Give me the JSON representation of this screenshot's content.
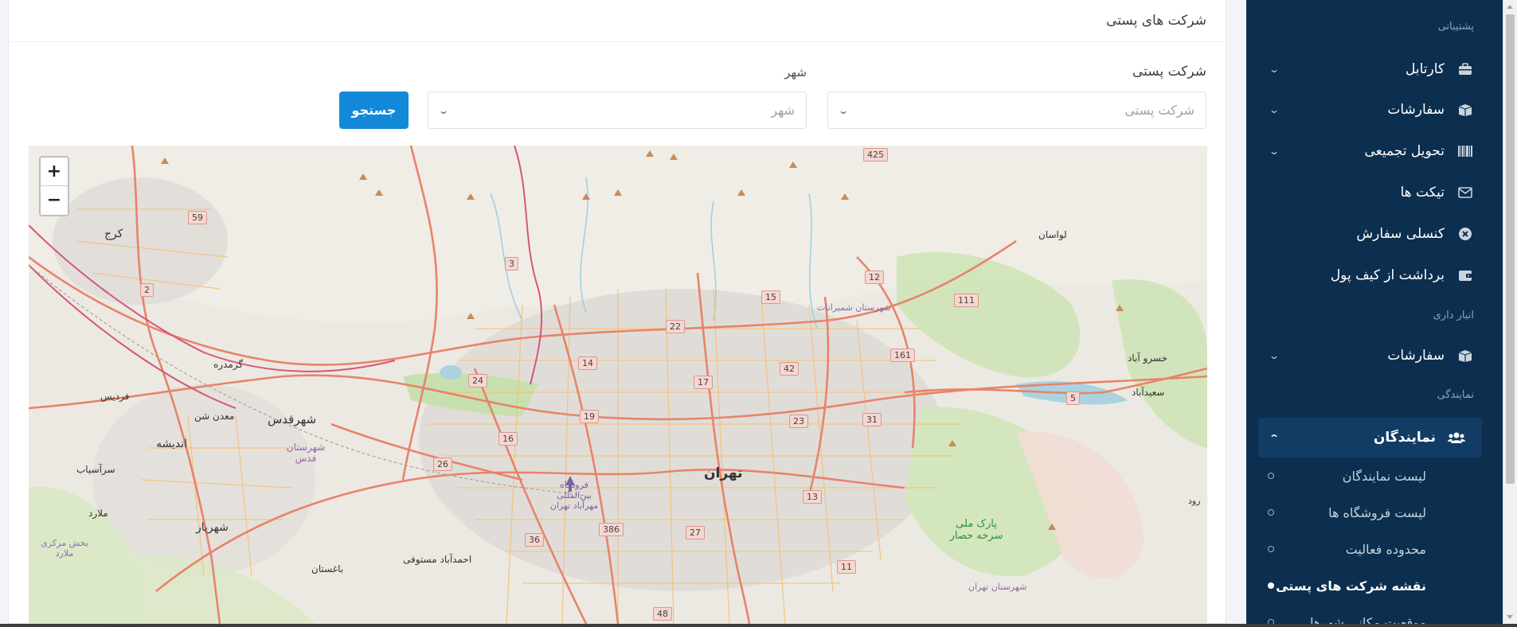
{
  "page": {
    "card_title": "شرکت های پستی"
  },
  "filters": {
    "company_label": "شرکت پستی",
    "company_placeholder": "شرکت پستی",
    "city_label": "شهر",
    "city_placeholder": "شهر",
    "search_button": "جستجو"
  },
  "map": {
    "zoom_in": "+",
    "zoom_out": "−",
    "labels": {
      "karaj": "کرج",
      "tehran": "تهران",
      "shahr_e_qods": "شهرقدس",
      "shahrestan_qods": "شهرستان قدس",
      "andisheh": "اندیشه",
      "shahriar": "شهریار",
      "lavasan": "لواسان",
      "khosro_abad": "خسرو آباد",
      "saeed_abad": "سعیدآباد",
      "sarasyab": "سرآسیاب",
      "malard": "ملارد",
      "bakhsh_malard": "بخش مرکزی ملارد",
      "baghestan": "باغستان",
      "ahmadabad": "احمدآباد مستوفی",
      "fardis": "فردیس",
      "gormdareh": "گرمدره",
      "madan_shen": "معدن شن",
      "national_park": "پارک ملی سرخه حصار",
      "airport": "فرودگاه بین‌المللی مهرآباد تهران",
      "shemiranat": "شهرستان شمیرانات",
      "shahrestan_tehran": "شهرستان تهران",
      "rood": "رود"
    },
    "road_shields": [
      "425",
      "59",
      "3",
      "2",
      "12",
      "15",
      "22",
      "111",
      "14",
      "42",
      "161",
      "24",
      "17",
      "5",
      "19",
      "23",
      "31",
      "16",
      "26",
      "13",
      "386",
      "27",
      "36",
      "11",
      "48"
    ]
  },
  "sidebar": {
    "section_support": "پشتیبانی",
    "items_support": [
      {
        "label": "کارتابل",
        "icon": "briefcase-icon",
        "has_chevron": true
      },
      {
        "label": "سفارشات",
        "icon": "box-icon",
        "has_chevron": true
      },
      {
        "label": "تحویل تجمیعی",
        "icon": "barcode-icon",
        "has_chevron": true
      },
      {
        "label": "تیکت ها",
        "icon": "envelope-icon",
        "has_chevron": false
      },
      {
        "label": "کنسلی سفارش",
        "icon": "cancel-circle-icon",
        "has_chevron": false
      },
      {
        "label": "برداشت از کیف پول",
        "icon": "wallet-icon",
        "has_chevron": false
      }
    ],
    "section_warehouse": "انبار داری",
    "items_warehouse": [
      {
        "label": "سفارشات",
        "icon": "box-icon",
        "has_chevron": true
      }
    ],
    "section_agency": "نمایندگی",
    "active_item": {
      "label": "نمایندگان",
      "icon": "users-icon"
    },
    "sub_items": [
      {
        "label": "لیست نمایندگان"
      },
      {
        "label": "لیست فروشگاه ها"
      },
      {
        "label": "محدوده فعالیت"
      },
      {
        "label": "نقشه شرکت های پستی"
      },
      {
        "label": "موقعیت مکانی شهرها"
      }
    ]
  },
  "colors": {
    "sidebar_bg": "#0c2f4f",
    "sidebar_active_bg": "#123c63",
    "primary_button": "#1289d8",
    "map_road_major": "#e8836a",
    "map_road_minor": "#f4c27a",
    "map_park": "#c8e0b0"
  }
}
